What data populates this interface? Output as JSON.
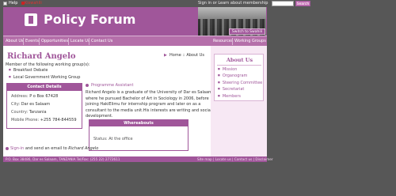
{
  "top": {
    "help": "Help",
    "language": "Kiswahili",
    "signin_text": "Sign in or Learn about membership",
    "search_button": "Search",
    "search_placeholder": ""
  },
  "header": {
    "title": "Policy Forum",
    "switch_button": "Switch to Swahili"
  },
  "nav": {
    "items": [
      "About Us",
      "Events",
      "Opportunities",
      "Locate Us",
      "Contact Us"
    ],
    "right_items": [
      "Resources",
      "Working Groups"
    ]
  },
  "main": {
    "name": "Richard Angelo",
    "breadcrumb": "Home :: About Us",
    "member_text": "Member of the following working group(s):",
    "groups": [
      "Breakfast Debate",
      "Local Government Working Group"
    ],
    "contact": {
      "title": "Contact Details",
      "address_label": "Address:",
      "address": "P o Box 67428",
      "city_label": "City:",
      "city": "Dar es Salaam",
      "country_label": "Country:",
      "country": "Tanzania",
      "mobile_label": "Mobile Phone:",
      "mobile": "+255 784-844559"
    },
    "role": "Programme Assistant",
    "bio": "Richard Angelo is a graduate of the University of Dar es Salaam where he pursued Bachelor of Art in Sociology in 2006, before joining HakiElimu for internship program and later on as a consultant to the media unit.His interests are writing and social development.",
    "whereabouts": {
      "title": "Whereabouts",
      "status_label": "Status:",
      "status": "At the office"
    },
    "signin_link": "Sign-in",
    "signin_rest": " and send an email to ",
    "signin_name": "Richard Angelo"
  },
  "sidebar": {
    "title": "About Us",
    "items": [
      "Mission",
      "Organogram",
      "Steering Committee",
      "Secretariat",
      "Members"
    ]
  },
  "footer": {
    "address": "P.O. Box 38486, Dar es Salaam, TANZANIA Tel/Fax: (255 22) 2772611",
    "links": "Site map | Locate us | Contact us | Disclaimer"
  },
  "colors": {
    "brand": "#a0569a",
    "nav": "#b56faa",
    "sidebar_bg": "#f7e8f4",
    "page_bg": "#575757"
  }
}
